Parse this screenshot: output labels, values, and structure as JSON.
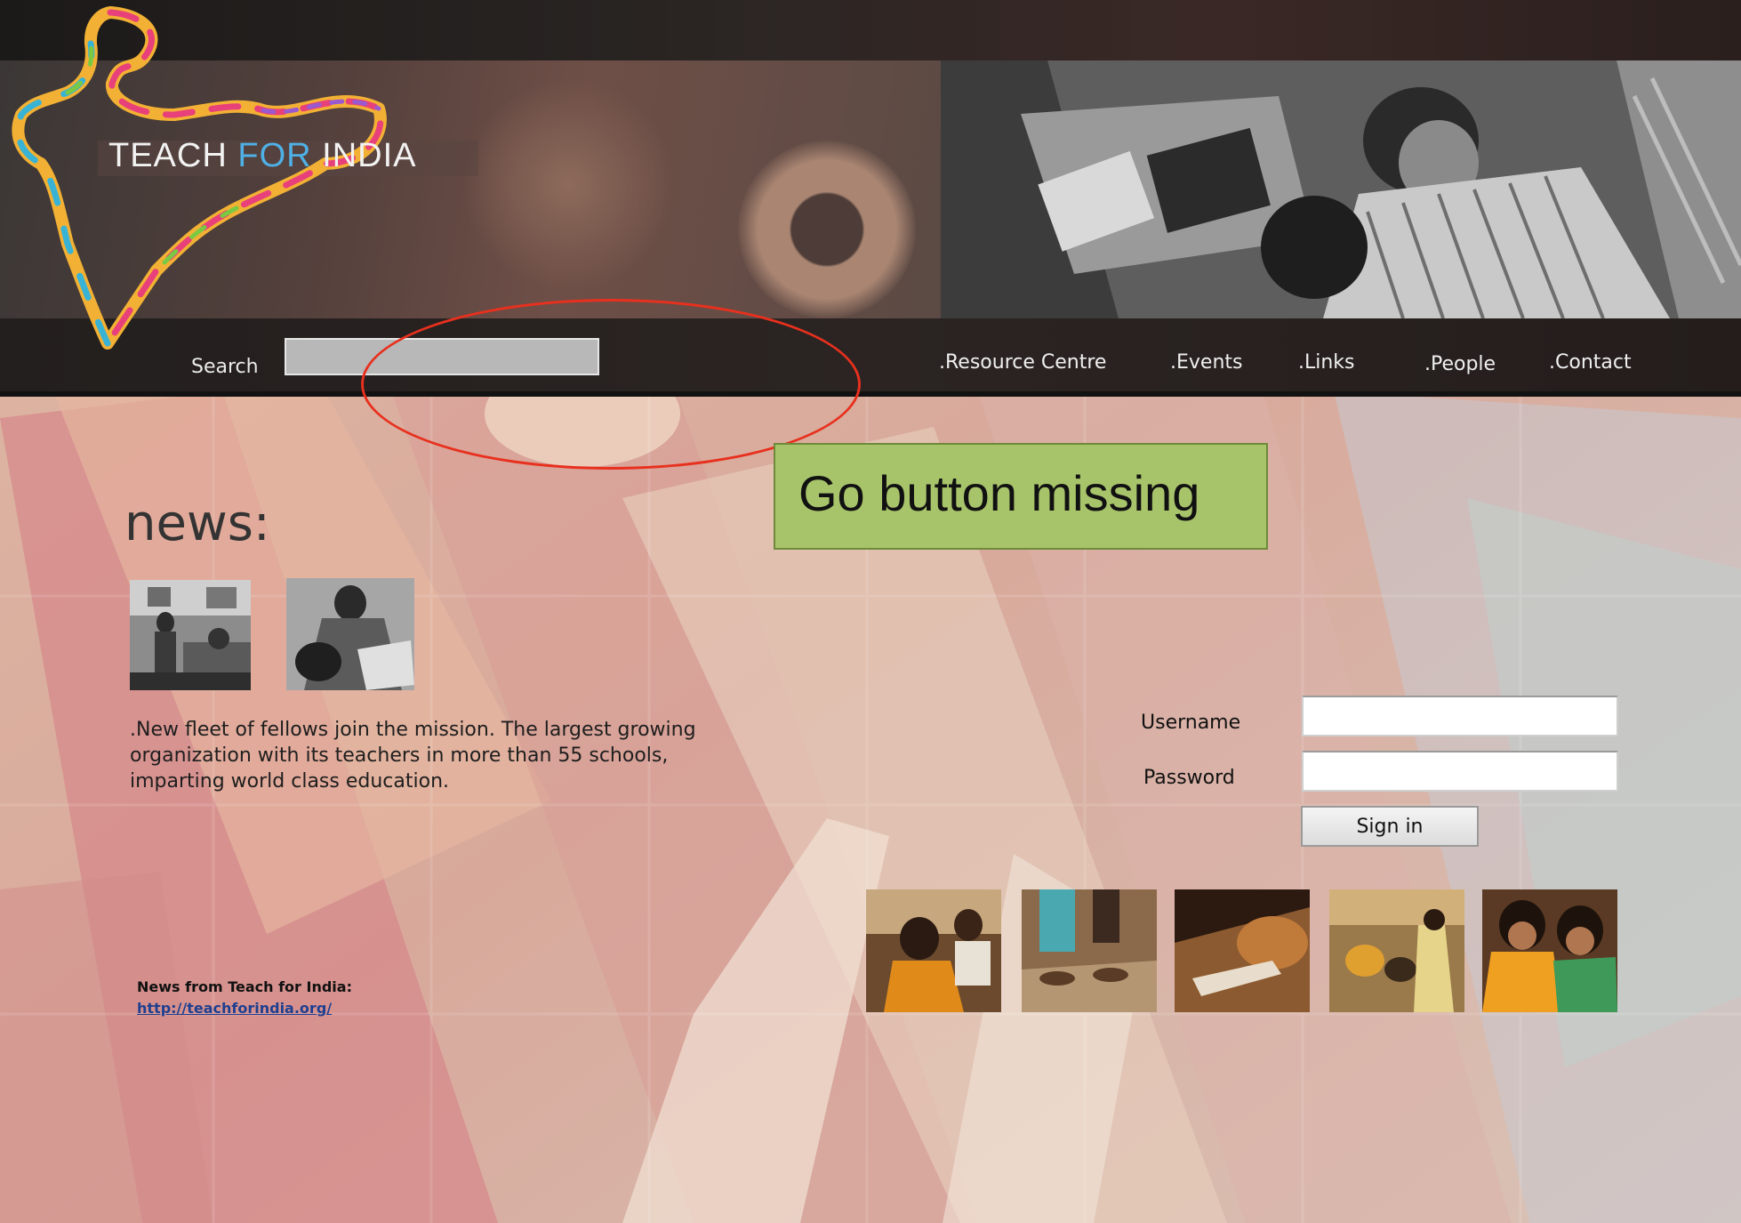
{
  "brand": {
    "name_part1": "TEACH ",
    "name_accent": "FOR",
    "name_part2": " INDIA"
  },
  "header": {
    "search_label": "Search",
    "search_value": "",
    "nav": [
      ".Resource Centre",
      ".Events",
      ".Links",
      ".People",
      ".Contact"
    ]
  },
  "annotation": {
    "text": "Go button missing",
    "color": "#e8301e",
    "box_color": "#a8c46a"
  },
  "news": {
    "heading": "news:",
    "body": ".New fleet of fellows join the mission. The largest growing organization with its teachers in more than 55 schools, imparting world class education.",
    "source_label": "News from Teach for India:",
    "source_link": "http://teachforindia.org/"
  },
  "login": {
    "username_label": "Username",
    "username_value": "",
    "password_label": "Password",
    "password_value": "",
    "signin_label": "Sign in"
  },
  "icons": [
    "india-map-logo-icon"
  ],
  "colors": {
    "brand_accent": "#4fb0e6",
    "navbar": "#231f1e"
  }
}
